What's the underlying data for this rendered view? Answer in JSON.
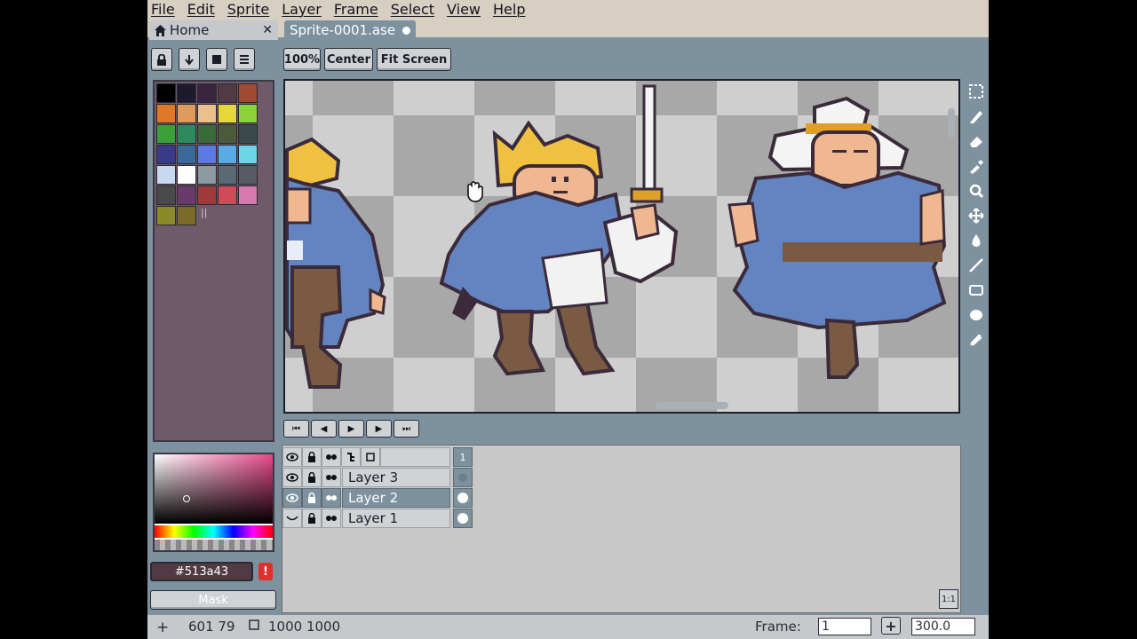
{
  "menu": [
    "File",
    "Edit",
    "Sprite",
    "Layer",
    "Frame",
    "Select",
    "View",
    "Help"
  ],
  "tabs": {
    "home": "Home",
    "sprite": "Sprite-0001.ase",
    "close_symbol": "✕"
  },
  "toolbar": {
    "zoom_label": "100%",
    "center_label": "Center",
    "fit_label": "Fit Screen"
  },
  "palette": {
    "colors": [
      "#000000",
      "#1d1a2f",
      "#3a2540",
      "#513a43",
      "#a04a32",
      "#e0782a",
      "#e09a5a",
      "#ecc08a",
      "#e6d83a",
      "#8cd03a",
      "#3aa03a",
      "#2c8a5e",
      "#3a6a3a",
      "#4a5a3a",
      "#3a4a4a",
      "#3a3a8a",
      "#3a6a9a",
      "#5a7ae6",
      "#5aaae6",
      "#6ad6e6",
      "#c8d8f0",
      "#ffffff",
      "#8a9aa0",
      "#5a6a72",
      "#5a5a66",
      "#4a4a4a",
      "#6a3a6a",
      "#a03a3a",
      "#d04a5a",
      "#d87ab0",
      "#8a8a2a",
      "#7a6a2a"
    ]
  },
  "timeline": {
    "frame_header": "1",
    "layers": [
      {
        "name": "Layer 3",
        "visible": true,
        "selected": false
      },
      {
        "name": "Layer 2",
        "visible": true,
        "selected": true
      },
      {
        "name": "Layer 1",
        "visible": false,
        "selected": false
      }
    ]
  },
  "color": {
    "hex": "#513a43",
    "warning": "!",
    "mask_label": "Mask"
  },
  "status": {
    "coords": "601 79",
    "size": "1000 1000",
    "frame_label": "Frame:",
    "frame_value": "1",
    "zoom_value": "300.0"
  },
  "icons": {
    "lock": "🔒︎",
    "playback": [
      "⏮",
      "◀",
      "▶",
      "▶",
      "⏭"
    ],
    "tools": [
      "marquee-icon",
      "pencil-icon",
      "eraser-icon",
      "eyedropper-icon",
      "zoom-icon",
      "move-icon",
      "fill-icon",
      "line-icon",
      "rectangle-icon",
      "ellipse-icon",
      "spray-icon"
    ]
  }
}
